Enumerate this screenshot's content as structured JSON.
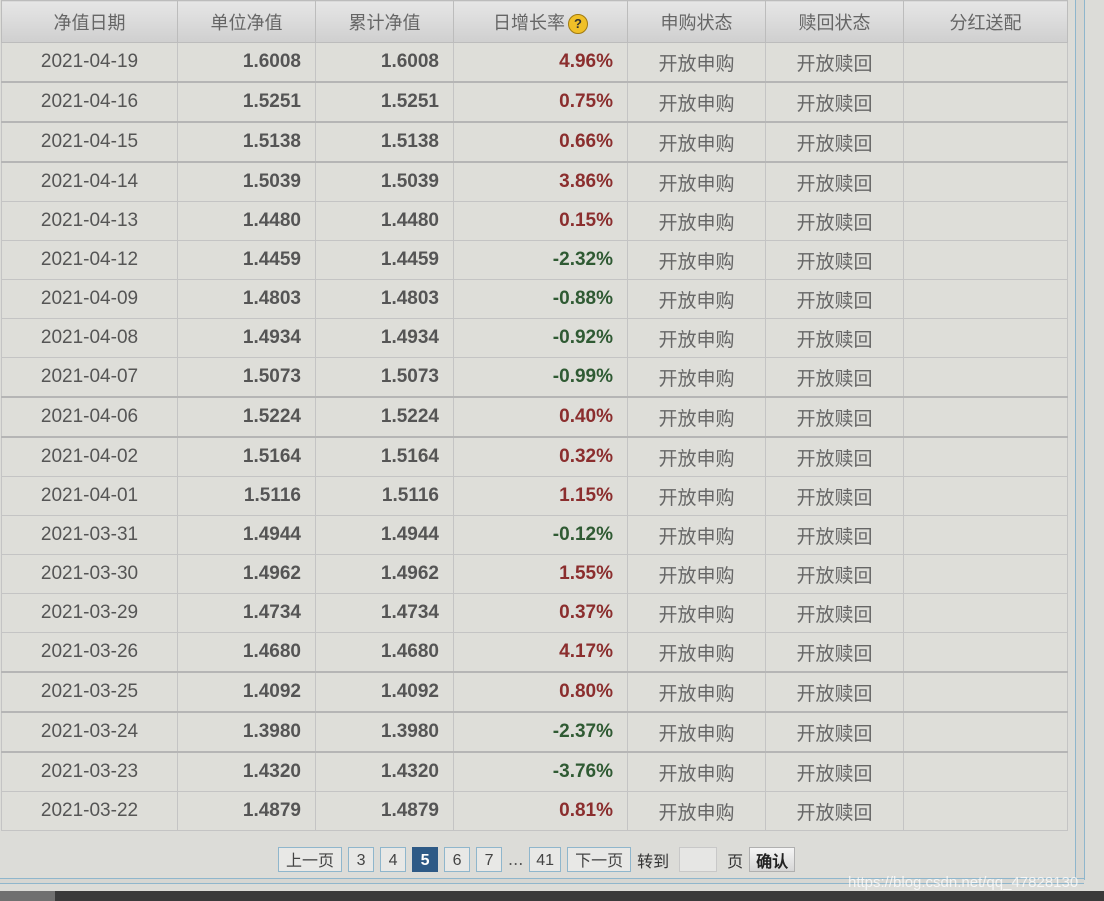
{
  "table": {
    "headers": {
      "date": "净值日期",
      "unit_nav": "单位净值",
      "cum_nav": "累计净值",
      "daily_growth": "日增长率",
      "purchase_status": "申购状态",
      "redeem_status": "赎回状态",
      "dividend": "分红送配"
    },
    "help_icon_glyph": "?",
    "rows": [
      {
        "date": "2021-04-19",
        "unit_nav": "1.6008",
        "cum_nav": "1.6008",
        "growth": "4.96%",
        "direction": "up",
        "purchase": "开放申购",
        "redeem": "开放赎回",
        "dividend": ""
      },
      {
        "date": "2021-04-16",
        "unit_nav": "1.5251",
        "cum_nav": "1.5251",
        "growth": "0.75%",
        "direction": "up",
        "purchase": "开放申购",
        "redeem": "开放赎回",
        "dividend": ""
      },
      {
        "date": "2021-04-15",
        "unit_nav": "1.5138",
        "cum_nav": "1.5138",
        "growth": "0.66%",
        "direction": "up",
        "purchase": "开放申购",
        "redeem": "开放赎回",
        "dividend": ""
      },
      {
        "date": "2021-04-14",
        "unit_nav": "1.5039",
        "cum_nav": "1.5039",
        "growth": "3.86%",
        "direction": "up",
        "purchase": "开放申购",
        "redeem": "开放赎回",
        "dividend": ""
      },
      {
        "date": "2021-04-13",
        "unit_nav": "1.4480",
        "cum_nav": "1.4480",
        "growth": "0.15%",
        "direction": "up",
        "purchase": "开放申购",
        "redeem": "开放赎回",
        "dividend": ""
      },
      {
        "date": "2021-04-12",
        "unit_nav": "1.4459",
        "cum_nav": "1.4459",
        "growth": "-2.32%",
        "direction": "down",
        "purchase": "开放申购",
        "redeem": "开放赎回",
        "dividend": ""
      },
      {
        "date": "2021-04-09",
        "unit_nav": "1.4803",
        "cum_nav": "1.4803",
        "growth": "-0.88%",
        "direction": "down",
        "purchase": "开放申购",
        "redeem": "开放赎回",
        "dividend": ""
      },
      {
        "date": "2021-04-08",
        "unit_nav": "1.4934",
        "cum_nav": "1.4934",
        "growth": "-0.92%",
        "direction": "down",
        "purchase": "开放申购",
        "redeem": "开放赎回",
        "dividend": ""
      },
      {
        "date": "2021-04-07",
        "unit_nav": "1.5073",
        "cum_nav": "1.5073",
        "growth": "-0.99%",
        "direction": "down",
        "purchase": "开放申购",
        "redeem": "开放赎回",
        "dividend": ""
      },
      {
        "date": "2021-04-06",
        "unit_nav": "1.5224",
        "cum_nav": "1.5224",
        "growth": "0.40%",
        "direction": "up",
        "purchase": "开放申购",
        "redeem": "开放赎回",
        "dividend": ""
      },
      {
        "date": "2021-04-02",
        "unit_nav": "1.5164",
        "cum_nav": "1.5164",
        "growth": "0.32%",
        "direction": "up",
        "purchase": "开放申购",
        "redeem": "开放赎回",
        "dividend": ""
      },
      {
        "date": "2021-04-01",
        "unit_nav": "1.5116",
        "cum_nav": "1.5116",
        "growth": "1.15%",
        "direction": "up",
        "purchase": "开放申购",
        "redeem": "开放赎回",
        "dividend": ""
      },
      {
        "date": "2021-03-31",
        "unit_nav": "1.4944",
        "cum_nav": "1.4944",
        "growth": "-0.12%",
        "direction": "down",
        "purchase": "开放申购",
        "redeem": "开放赎回",
        "dividend": ""
      },
      {
        "date": "2021-03-30",
        "unit_nav": "1.4962",
        "cum_nav": "1.4962",
        "growth": "1.55%",
        "direction": "up",
        "purchase": "开放申购",
        "redeem": "开放赎回",
        "dividend": ""
      },
      {
        "date": "2021-03-29",
        "unit_nav": "1.4734",
        "cum_nav": "1.4734",
        "growth": "0.37%",
        "direction": "up",
        "purchase": "开放申购",
        "redeem": "开放赎回",
        "dividend": ""
      },
      {
        "date": "2021-03-26",
        "unit_nav": "1.4680",
        "cum_nav": "1.4680",
        "growth": "4.17%",
        "direction": "up",
        "purchase": "开放申购",
        "redeem": "开放赎回",
        "dividend": ""
      },
      {
        "date": "2021-03-25",
        "unit_nav": "1.4092",
        "cum_nav": "1.4092",
        "growth": "0.80%",
        "direction": "up",
        "purchase": "开放申购",
        "redeem": "开放赎回",
        "dividend": ""
      },
      {
        "date": "2021-03-24",
        "unit_nav": "1.3980",
        "cum_nav": "1.3980",
        "growth": "-2.37%",
        "direction": "down",
        "purchase": "开放申购",
        "redeem": "开放赎回",
        "dividend": ""
      },
      {
        "date": "2021-03-23",
        "unit_nav": "1.4320",
        "cum_nav": "1.4320",
        "growth": "-3.76%",
        "direction": "down",
        "purchase": "开放申购",
        "redeem": "开放赎回",
        "dividend": ""
      },
      {
        "date": "2021-03-22",
        "unit_nav": "1.4879",
        "cum_nav": "1.4879",
        "growth": "0.81%",
        "direction": "up",
        "purchase": "开放申购",
        "redeem": "开放赎回",
        "dividend": ""
      }
    ]
  },
  "pager": {
    "prev_label": "上一页",
    "pages": [
      "3",
      "4",
      "5",
      "6",
      "7"
    ],
    "current_page": "5",
    "ellipsis": "...",
    "last_page": "41",
    "next_label": "下一页",
    "goto_label": "转到",
    "goto_value": "",
    "page_unit": "页",
    "confirm_label": "确认"
  },
  "watermark": "https://blog.csdn.net/qq_47828130",
  "colors": {
    "up": "#8b2e2e",
    "down": "#2f5a33",
    "current_page_bg": "#2e5a86"
  }
}
